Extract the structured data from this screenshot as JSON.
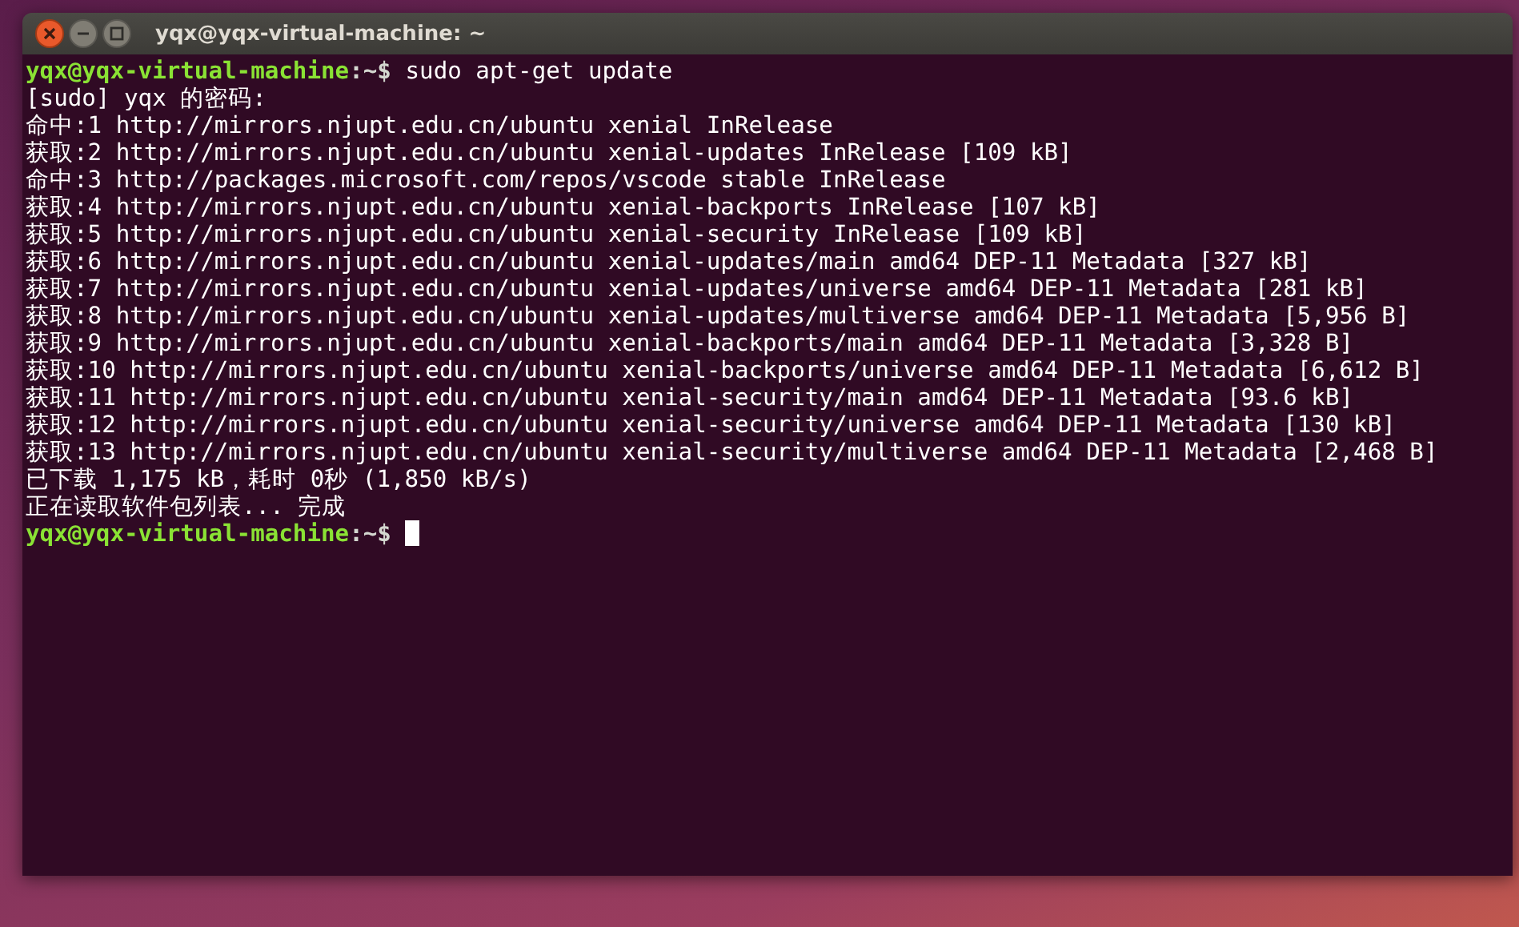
{
  "window": {
    "title": "yqx@yqx-virtual-machine: ~"
  },
  "terminal": {
    "lines": [
      {
        "kind": "prompt",
        "user_host": "yqx@yqx-virtual-machine",
        "suffix": ":~$",
        "command": "sudo apt-get update",
        "cursor": false
      },
      {
        "kind": "output",
        "text": "[sudo] yqx 的密码:"
      },
      {
        "kind": "output",
        "text": "命中:1 http://mirrors.njupt.edu.cn/ubuntu xenial InRelease"
      },
      {
        "kind": "output",
        "text": "获取:2 http://mirrors.njupt.edu.cn/ubuntu xenial-updates InRelease [109 kB]"
      },
      {
        "kind": "output",
        "text": "命中:3 http://packages.microsoft.com/repos/vscode stable InRelease"
      },
      {
        "kind": "output",
        "text": "获取:4 http://mirrors.njupt.edu.cn/ubuntu xenial-backports InRelease [107 kB]"
      },
      {
        "kind": "output",
        "text": "获取:5 http://mirrors.njupt.edu.cn/ubuntu xenial-security InRelease [109 kB]"
      },
      {
        "kind": "output",
        "text": "获取:6 http://mirrors.njupt.edu.cn/ubuntu xenial-updates/main amd64 DEP-11 Metadata [327 kB]"
      },
      {
        "kind": "output",
        "text": "获取:7 http://mirrors.njupt.edu.cn/ubuntu xenial-updates/universe amd64 DEP-11 Metadata [281 kB]"
      },
      {
        "kind": "output",
        "text": "获取:8 http://mirrors.njupt.edu.cn/ubuntu xenial-updates/multiverse amd64 DEP-11 Metadata [5,956 B]"
      },
      {
        "kind": "output",
        "text": "获取:9 http://mirrors.njupt.edu.cn/ubuntu xenial-backports/main amd64 DEP-11 Metadata [3,328 B]"
      },
      {
        "kind": "output",
        "text": "获取:10 http://mirrors.njupt.edu.cn/ubuntu xenial-backports/universe amd64 DEP-11 Metadata [6,612 B]"
      },
      {
        "kind": "output",
        "text": "获取:11 http://mirrors.njupt.edu.cn/ubuntu xenial-security/main amd64 DEP-11 Metadata [93.6 kB]"
      },
      {
        "kind": "output",
        "text": "获取:12 http://mirrors.njupt.edu.cn/ubuntu xenial-security/universe amd64 DEP-11 Metadata [130 kB]"
      },
      {
        "kind": "output",
        "text": "获取:13 http://mirrors.njupt.edu.cn/ubuntu xenial-security/multiverse amd64 DEP-11 Metadata [2,468 B]"
      },
      {
        "kind": "output",
        "text": "已下载 1,175 kB，耗时 0秒 (1,850 kB/s)"
      },
      {
        "kind": "output",
        "text": "正在读取软件包列表... 完成"
      },
      {
        "kind": "prompt",
        "user_host": "yqx@yqx-virtual-machine",
        "suffix": ":~$",
        "cursor": true
      }
    ]
  }
}
